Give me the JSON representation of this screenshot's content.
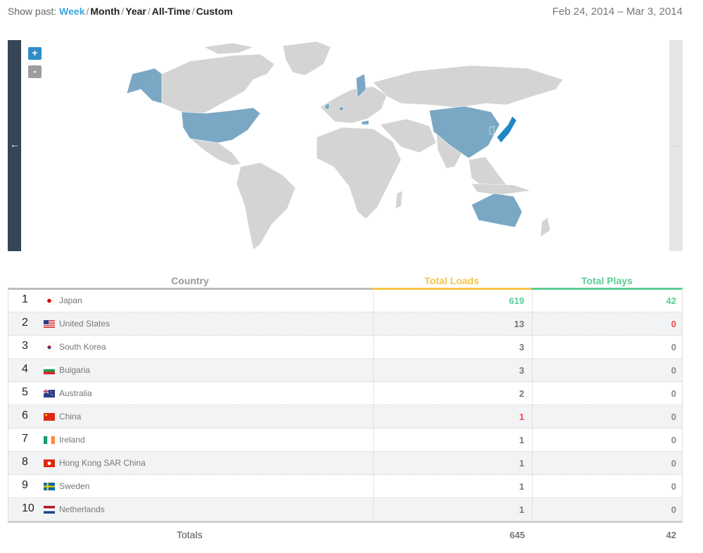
{
  "filter": {
    "label": "Show past:",
    "options": [
      "Week",
      "Month",
      "Year",
      "All-Time",
      "Custom"
    ],
    "active": "Week",
    "separator": "/"
  },
  "date_range": "Feb 24, 2014 – Mar 3, 2014",
  "map": {
    "zoom_in": "+",
    "zoom_out": "-",
    "nav_left_icon": "arrow-left-icon",
    "nav_right_icon": "arrow-right-icon",
    "colors": {
      "land": "#d4d4d4",
      "highlight": "#7aa8c4",
      "top": "#1f86c5",
      "nav_dark": "#364556"
    }
  },
  "table": {
    "headers": {
      "country": "Country",
      "loads": "Total Loads",
      "plays": "Total Plays"
    },
    "rows": [
      {
        "rank": "1",
        "flag": "jp",
        "country": "Japan",
        "loads": "619",
        "plays": "42"
      },
      {
        "rank": "2",
        "flag": "us",
        "country": "United States",
        "loads": "13",
        "plays": "0"
      },
      {
        "rank": "3",
        "flag": "kr",
        "country": "South Korea",
        "loads": "3",
        "plays": "0"
      },
      {
        "rank": "4",
        "flag": "bg",
        "country": "Bulgaria",
        "loads": "3",
        "plays": "0"
      },
      {
        "rank": "5",
        "flag": "au",
        "country": "Australia",
        "loads": "2",
        "plays": "0"
      },
      {
        "rank": "6",
        "flag": "cn",
        "country": "China",
        "loads": "1",
        "plays": "0"
      },
      {
        "rank": "7",
        "flag": "ie",
        "country": "Ireland",
        "loads": "1",
        "plays": "0"
      },
      {
        "rank": "8",
        "flag": "hk",
        "country": "Hong Kong SAR China",
        "loads": "1",
        "plays": "0"
      },
      {
        "rank": "9",
        "flag": "se",
        "country": "Sweden",
        "loads": "1",
        "plays": "0"
      },
      {
        "rank": "10",
        "flag": "nl",
        "country": "Netherlands",
        "loads": "1",
        "plays": "0"
      }
    ],
    "totals": {
      "label": "Totals",
      "loads": "645",
      "plays": "42"
    },
    "colors": {
      "green": "#5ccc94",
      "red": "#e94b4b",
      "loads_header": "#f4c44a"
    }
  }
}
